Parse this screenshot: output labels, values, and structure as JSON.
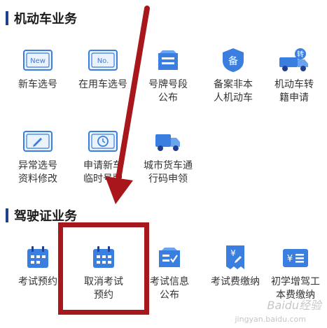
{
  "sections": [
    {
      "title": "机动车业务",
      "items": [
        {
          "label": "新车选号",
          "icon": "new-plate-icon"
        },
        {
          "label": "在用车选号",
          "icon": "no-plate-icon"
        },
        {
          "label": "号牌号段\n公布",
          "icon": "plate-list-icon"
        },
        {
          "label": "备案非本\n人机动车",
          "icon": "record-shield-icon"
        },
        {
          "label": "机动车转\n籍申请",
          "icon": "truck-transfer-icon"
        },
        {
          "label": "异常选号\n资料修改",
          "icon": "edit-plate-icon"
        },
        {
          "label": "申请新车\n临时号牌",
          "icon": "temp-plate-clock-icon"
        },
        {
          "label": "城市货车通\n行码申领",
          "icon": "truck-pass-icon"
        }
      ]
    },
    {
      "title": "驾驶证业务",
      "items": [
        {
          "label": "考试预约",
          "icon": "calendar-icon"
        },
        {
          "label": "取消考试\n预约",
          "icon": "calendar-cancel-icon"
        },
        {
          "label": "考试信息\n公布",
          "icon": "exam-info-icon"
        },
        {
          "label": "考试费缴纳",
          "icon": "receipt-yen-icon"
        },
        {
          "label": "初学增驾工\n本费缴纳",
          "icon": "payment-yen-icon"
        }
      ]
    }
  ],
  "badges": {
    "new_plate": "New",
    "no_plate": "No.",
    "record": "备",
    "transfer": "转",
    "yen": "¥"
  },
  "watermark": {
    "text": "Baidu经验",
    "sub": "jingyan.baidu.com"
  },
  "colors": {
    "icon_blue": "#3a7ee0",
    "accent_dark": "#1f3f8f",
    "annotation_red": "#a8171c"
  }
}
